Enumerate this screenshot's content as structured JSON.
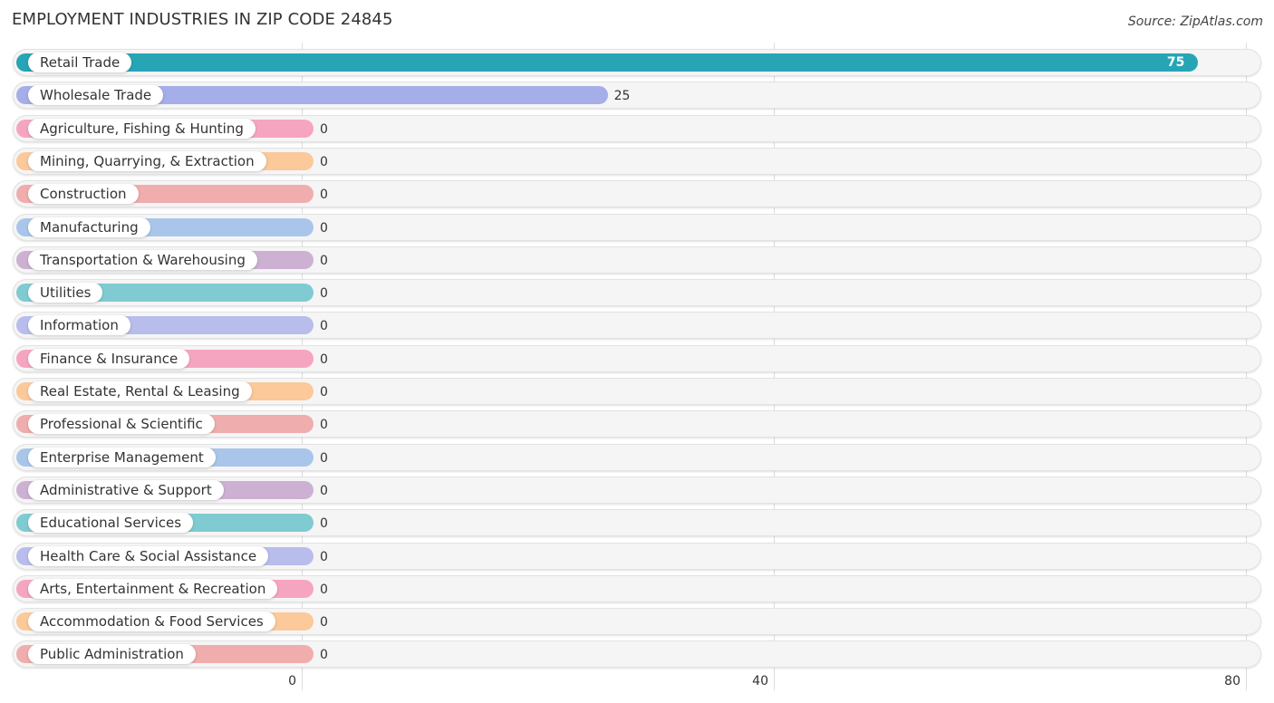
{
  "header": {
    "title": "EMPLOYMENT INDUSTRIES IN ZIP CODE 24845",
    "source": "Source: ZipAtlas.com"
  },
  "chart_data": {
    "type": "bar",
    "orientation": "horizontal",
    "title": "EMPLOYMENT INDUSTRIES IN ZIP CODE 24845",
    "xlabel": "",
    "ylabel": "",
    "xlim": [
      0,
      80
    ],
    "xticks": [
      0,
      40,
      80
    ],
    "xtick_labels": [
      "0",
      "40",
      "80"
    ],
    "grid": true,
    "categories": [
      "Retail Trade",
      "Wholesale Trade",
      "Agriculture, Fishing & Hunting",
      "Mining, Quarrying, & Extraction",
      "Construction",
      "Manufacturing",
      "Transportation & Warehousing",
      "Utilities",
      "Information",
      "Finance & Insurance",
      "Real Estate, Rental & Leasing",
      "Professional & Scientific",
      "Enterprise Management",
      "Administrative & Support",
      "Educational Services",
      "Health Care & Social Assistance",
      "Arts, Entertainment & Recreation",
      "Accommodation & Food Services",
      "Public Administration"
    ],
    "values": [
      75,
      25,
      0,
      0,
      0,
      0,
      0,
      0,
      0,
      0,
      0,
      0,
      0,
      0,
      0,
      0,
      0,
      0,
      0
    ],
    "value_labels": [
      "75",
      "25",
      "0",
      "0",
      "0",
      "0",
      "0",
      "0",
      "0",
      "0",
      "0",
      "0",
      "0",
      "0",
      "0",
      "0",
      "0",
      "0",
      "0"
    ],
    "colors": [
      "#27a5b5",
      "#a5aee8",
      "#f6a5c0",
      "#fbc99a",
      "#f0adad",
      "#a9c6ea",
      "#cdb1d3",
      "#7fcbd1",
      "#b8bdec",
      "#f6a5c0",
      "#fbc99a",
      "#f0adad",
      "#a9c6ea",
      "#cdb1d3",
      "#7fcbd1",
      "#b8bdec",
      "#f6a5c0",
      "#fbc99a",
      "#f0adad"
    ]
  }
}
